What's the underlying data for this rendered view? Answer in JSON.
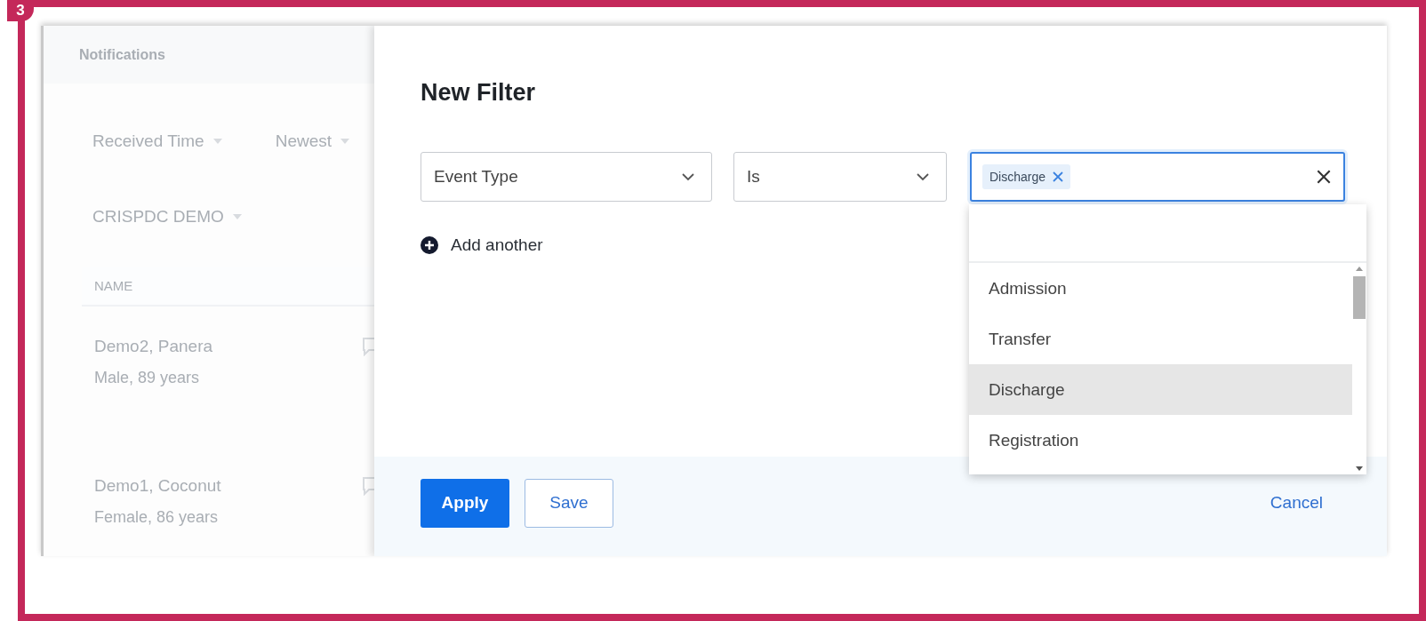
{
  "badge": "3",
  "background_panel": {
    "title": "Notifications",
    "sort_field": "Received Time",
    "sort_order": "Newest",
    "group": "CRISPDC DEMO",
    "table": {
      "columns": [
        "NAME"
      ],
      "rows": [
        {
          "name": "Demo2, Panera",
          "detail": "Male, 89 years"
        },
        {
          "name": "Demo1, Coconut",
          "detail": "Female, 86 years"
        }
      ]
    }
  },
  "modal": {
    "title": "New Filter",
    "field": {
      "value": "Event Type"
    },
    "operator": {
      "value": "Is"
    },
    "values": {
      "tags": [
        "Discharge"
      ],
      "focused": true
    },
    "add_label": "Add another",
    "dropdown": {
      "options": [
        {
          "label": "Admission",
          "selected": false
        },
        {
          "label": "Transfer",
          "selected": false
        },
        {
          "label": "Discharge",
          "selected": true
        },
        {
          "label": "Registration",
          "selected": false
        }
      ]
    },
    "buttons": [
      {
        "label": "Apply",
        "kind": "primary"
      },
      {
        "label": "Save",
        "kind": "secondary"
      },
      {
        "label": "Cancel",
        "kind": "link"
      }
    ]
  }
}
